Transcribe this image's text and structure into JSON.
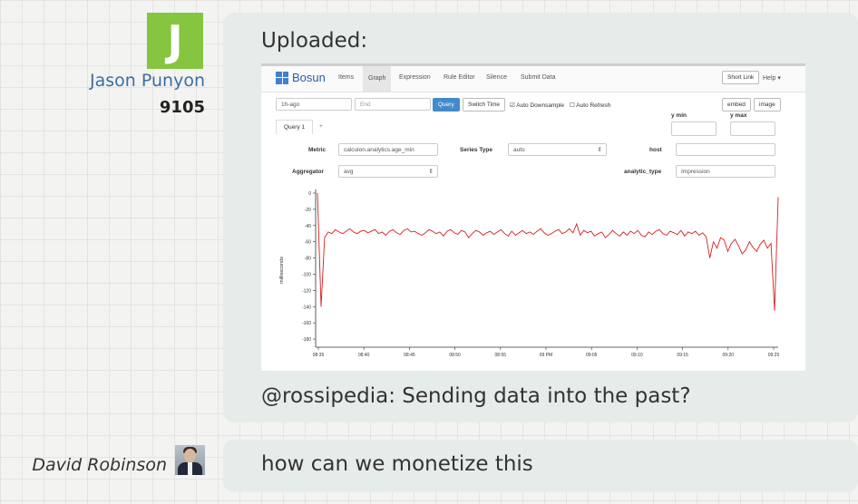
{
  "messages": [
    {
      "user": {
        "name": "Jason Punyon",
        "rep": "9105",
        "avatar_letter": "J",
        "avatar_color": "#86c540"
      },
      "text_top": "Uploaded:",
      "text_bottom": "@rossipedia: Sending data into the past?"
    },
    {
      "user": {
        "name": "David Robinson"
      },
      "text": "how can we monetize this"
    }
  ],
  "screenshot": {
    "brand": "Bosun",
    "nav": [
      "Items",
      "Graph",
      "Expression",
      "Rule Editor",
      "Silence",
      "Submit Data"
    ],
    "nav_active": "Graph",
    "short_link": "Short Link",
    "help": "Help ▾",
    "start_value": "1h-ago",
    "end_placeholder": "End",
    "query_btn": "Query",
    "switch_time": "Switch Time",
    "auto_downsample": "Auto Downsample",
    "auto_refresh": "Auto Refresh",
    "embed": "embed",
    "image": "image",
    "ymin_label": "y min",
    "ymax_label": "y max",
    "tab_query": "Query 1",
    "tab_add": "+",
    "metric_label": "Metric",
    "metric_value": "calculon.analytics.age_min",
    "series_type_label": "Series Type",
    "series_type_value": "auto",
    "host_label": "host",
    "aggregator_label": "Aggregator",
    "aggregator_value": "avg",
    "analytic_type_label": "analytic_type",
    "analytic_type_value": "Impression"
  },
  "chart_data": {
    "type": "line",
    "ylabel": "milliseconds",
    "ylim": [
      -190,
      0
    ],
    "y_ticks": [
      0,
      -20,
      -40,
      -60,
      -80,
      -100,
      -120,
      -140,
      -160,
      -180
    ],
    "x_tick_labels": [
      "08:35",
      "08:40",
      "08:45",
      "08:50",
      "08:55",
      "09 PM",
      "09:05",
      "09:10",
      "09:15",
      "09:20",
      "09:25"
    ],
    "line_color": "#d62020",
    "series": [
      {
        "values": [
          0,
          -140,
          -55,
          -48,
          -50,
          -45,
          -48,
          -50,
          -47,
          -44,
          -48,
          -50,
          -47,
          -46,
          -49,
          -47,
          -45,
          -50,
          -48,
          -52,
          -47,
          -45,
          -49,
          -51,
          -46,
          -44,
          -48,
          -47,
          -50,
          -52,
          -49,
          -45,
          -47,
          -50,
          -48,
          -53,
          -47,
          -45,
          -49,
          -51,
          -46,
          -48,
          -55,
          -50,
          -46,
          -48,
          -52,
          -49,
          -47,
          -51,
          -48,
          -45,
          -50,
          -53,
          -47,
          -52,
          -49,
          -46,
          -50,
          -48,
          -51,
          -47,
          -44,
          -49,
          -52,
          -50,
          -47,
          -45,
          -50,
          -48,
          -44,
          -49,
          -38,
          -52,
          -46,
          -49,
          -47,
          -53,
          -50,
          -48,
          -55,
          -51,
          -46,
          -50,
          -53,
          -48,
          -52,
          -47,
          -50,
          -46,
          -52,
          -54,
          -48,
          -51,
          -47,
          -45,
          -50,
          -52,
          -47,
          -49,
          -51,
          -46,
          -53,
          -48,
          -50,
          -47,
          -52,
          -49,
          -54,
          -80,
          -60,
          -68,
          -55,
          -58,
          -72,
          -62,
          -57,
          -65,
          -75,
          -70,
          -60,
          -67,
          -72,
          -63,
          -58,
          -68,
          -62,
          -145,
          -5
        ]
      }
    ]
  }
}
